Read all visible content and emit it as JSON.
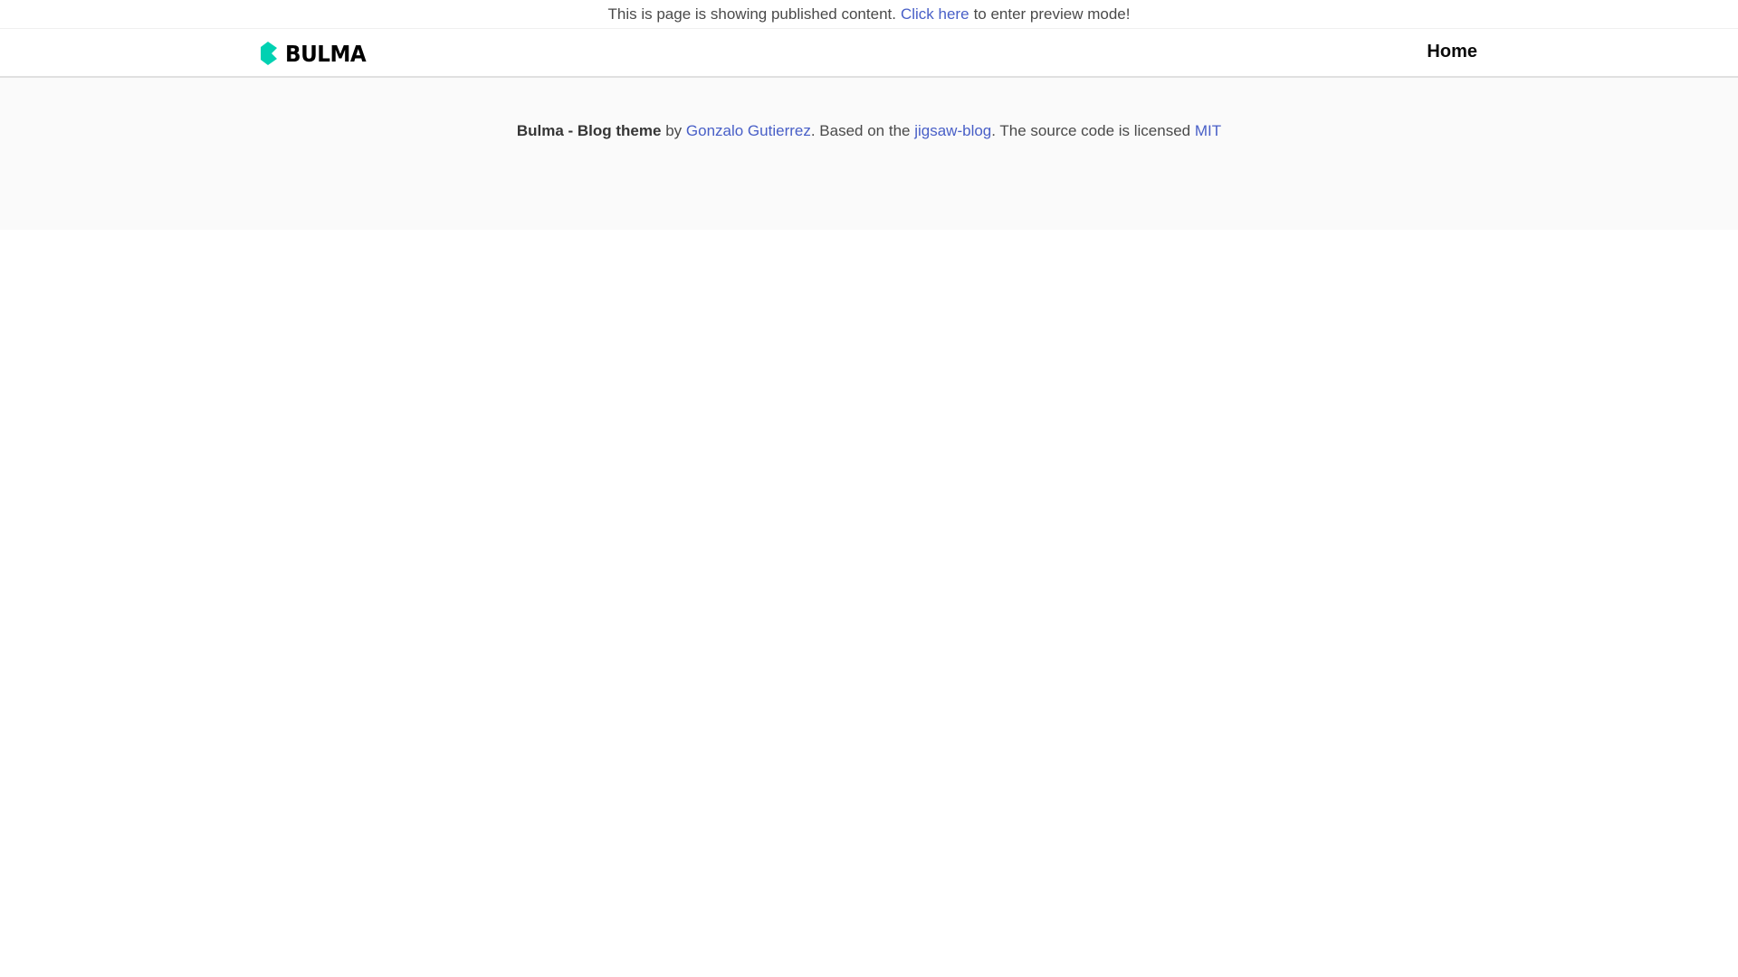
{
  "preview_bar": {
    "text_before": "This is page is showing published content.",
    "link_label": "Click here",
    "text_after": "to enter preview mode!"
  },
  "navbar": {
    "brand": {
      "icon": "bulma-logo-icon",
      "text": "BULMA",
      "color": "#00d1b2"
    },
    "items": [
      {
        "label": "Home"
      }
    ]
  },
  "footer": {
    "theme_name": "Bulma - Blog theme",
    "by": "by",
    "author_link": "Gonzalo Gutierrez",
    "based_on": ". Based on the",
    "base_link": "jigsaw-blog",
    "license_text": ". The source code is licensed",
    "license_link": "MIT"
  },
  "colors": {
    "link": "#485fc7",
    "text": "#4a4a4a",
    "footer_bg": "#fafafa",
    "brand": "#00d1b2"
  }
}
